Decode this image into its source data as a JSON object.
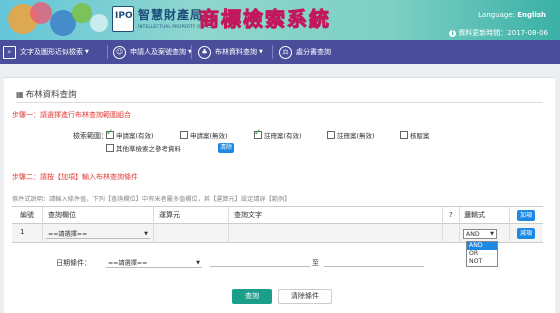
{
  "header": {
    "org_name": "智慧財產局",
    "org_name_en": "INTELLECTUAL PROPERTY OFFICE",
    "logo_text": "IPO",
    "system_title": "商標檢索系統",
    "language_label": "Language:",
    "language_value": "English",
    "update_label": "資料更新時間：2017-08-06"
  },
  "nav": {
    "items": [
      {
        "label": "文字及圖形近似檢索",
        "icon": "search-icon",
        "has_caret": true
      },
      {
        "label": "申請人及案號查詢",
        "icon": "user-icon",
        "has_caret": true
      },
      {
        "label": "布林資料查詢",
        "icon": "tree-icon",
        "has_caret": true
      },
      {
        "label": "處分書查詢",
        "icon": "gavel-icon",
        "has_caret": false
      }
    ]
  },
  "panel": {
    "title": "布林資料查詢",
    "step1": "步驟一：請選擇進行布林查詢範圍組合",
    "scope_label": "檢索範圍：",
    "checkboxes": [
      {
        "label": "申請案(有效)",
        "checked": true
      },
      {
        "label": "申請案(無效)",
        "checked": false
      },
      {
        "label": "註冊案(有效)",
        "checked": true
      },
      {
        "label": "註冊案(無效)",
        "checked": false
      },
      {
        "label": "核駁案",
        "checked": false
      },
      {
        "label": "其他準檢索之參考資料",
        "checked": false
      }
    ],
    "clear_btn": "清除",
    "step2": "步驟二：請按【加項】輸入布林查詢條件",
    "note": "條件式說明：請輸入條件值，下列【查詢欄位】中有米者屬多值欄位，其【運算元】設定請詳【範例】",
    "table": {
      "headers": [
        "編號",
        "查詢欄位",
        "運算元",
        "查詢文字",
        "?",
        "邏輯式"
      ],
      "add_btn": "加項",
      "remove_btn": "減項",
      "row": {
        "no": "1",
        "field": "==請選擇==",
        "logic": "AND"
      },
      "logic_options": [
        "AND",
        "OR",
        "NOT"
      ]
    },
    "date_label": "日期條件：",
    "date_select": "==請選擇==",
    "to_label": "至",
    "search_btn": "查詢",
    "reset_btn": "清除條件"
  }
}
